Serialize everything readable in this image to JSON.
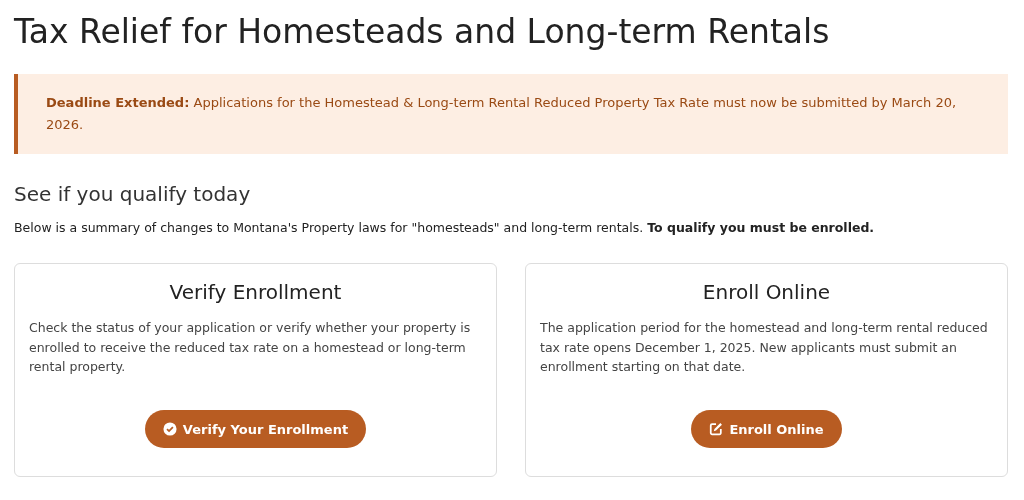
{
  "page_title": "Tax Relief for Homesteads and Long-term Rentals",
  "notice": {
    "label": "Deadline Extended:",
    "text": "Applications for the Homestead & Long-term Rental Reduced Property Tax Rate must now be submitted by March 20, 2026."
  },
  "section_heading": "See if you qualify today",
  "intro": "Below is a summary of changes to Montana's Property laws for \"homesteads\" and long-term rentals. **To qualify you must be enrolled.**",
  "cards": [
    {
      "title": "Verify Enrollment",
      "text": "Check the status of your application or verify whether your property is enrolled to receive the reduced tax rate on a homestead or long-term rental property.",
      "button": {
        "label": "Verify Your Enrollment",
        "kind": "check"
      }
    },
    {
      "title": "Enroll Online",
      "text": "The application period for the homestead and long-term rental reduced tax rate opens December 1, 2025. New applicants must submit an enrollment starting on that date.",
      "button": {
        "label": "Enroll Online",
        "kind": "edit"
      }
    }
  ]
}
